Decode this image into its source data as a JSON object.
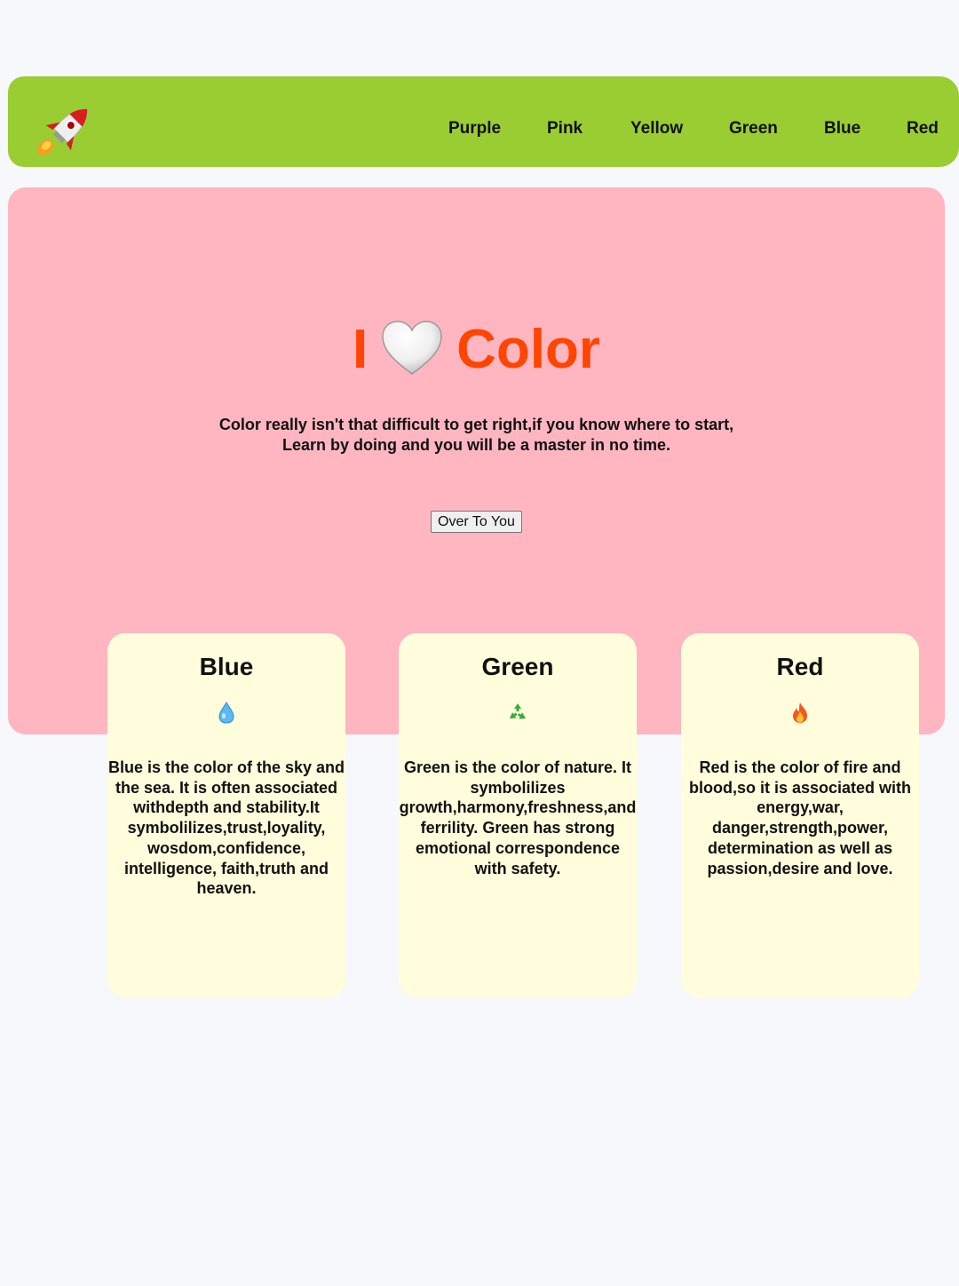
{
  "nav": {
    "logo_icon": "rocket-icon",
    "links": [
      "Purple",
      "Pink",
      "Yellow",
      "Green",
      "Blue",
      "Red"
    ]
  },
  "hero": {
    "title_left": "I",
    "title_icon": "white-heart-icon",
    "title_right": "Color",
    "description_lines": [
      "Color really isn't that difficult to get right,if you know where to start,",
      "Learn by doing and you will be a master in no time."
    ],
    "button_label": "Over To You"
  },
  "cards": [
    {
      "title": "Blue",
      "icon": "water-drop-icon",
      "text_lines": [
        "Blue is the color of the sky and",
        "the sea. It is often associated",
        "withdepth and stability.It",
        "symbolilizes,trust,loyality,",
        "wosdom,confidence,",
        "intelligence, faith,truth and",
        "heaven."
      ]
    },
    {
      "title": "Green",
      "icon": "recycle-icon",
      "text_lines": [
        "Green is the color of nature. It",
        "symbolilizes",
        "growth,harmony,freshness,and",
        "ferrility. Green has strong",
        "emotional correspondence",
        "with safety."
      ]
    },
    {
      "title": "Red",
      "icon": "fire-icon",
      "text_lines": [
        "Red is the color of fire and",
        "blood,so it is associated with",
        "energy,war,",
        "danger,strength,power,",
        "determination as well as",
        "passion,desire and love."
      ]
    }
  ],
  "colors": {
    "page_background": "#f6f8fc",
    "navbar": "#9acd32",
    "hero": "#ffb6c1",
    "title": "#ff4500",
    "card": "#fffddc"
  }
}
